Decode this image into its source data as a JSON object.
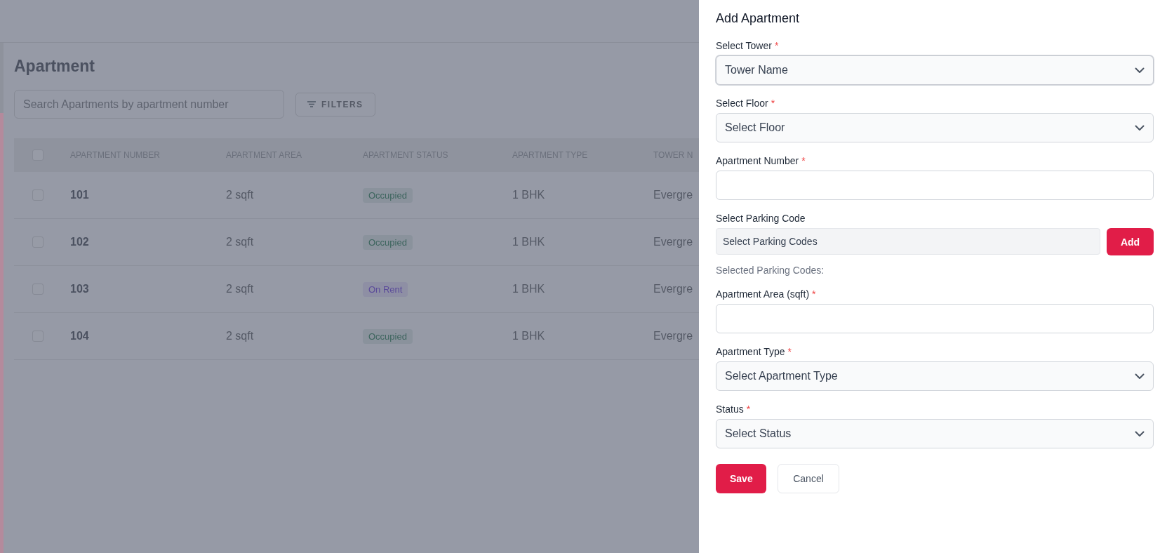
{
  "page": {
    "title": "Apartment",
    "search": {
      "placeholder": "Search Apartments by apartment number"
    },
    "filters_button": "FILTERS"
  },
  "table": {
    "header_checkbox": {
      "checked": false
    },
    "columns": [
      "APARTMENT NUMBER",
      "APARTMENT AREA",
      "APARTMENT STATUS",
      "APARTMENT TYPE",
      "TOWER N"
    ],
    "rows": [
      {
        "checked": false,
        "number": "101",
        "area": "2 sqft",
        "status": {
          "label": "Occupied",
          "color": "#3d655e"
        },
        "type": "1 BHK",
        "tower": "Evergre"
      },
      {
        "checked": false,
        "number": "102",
        "area": "2 sqft",
        "status": {
          "label": "Occupied",
          "color": "#3d655e"
        },
        "type": "1 BHK",
        "tower": "Evergre"
      },
      {
        "checked": false,
        "number": "103",
        "area": "2 sqft",
        "status": {
          "label": "On Rent",
          "color": "#5b4b9a"
        },
        "type": "1 BHK",
        "tower": "Evergre"
      },
      {
        "checked": false,
        "number": "104",
        "area": "2 sqft",
        "status": {
          "label": "Occupied",
          "color": "#3d655e"
        },
        "type": "1 BHK",
        "tower": "Evergre"
      }
    ]
  },
  "drawer": {
    "title": "Add Apartment",
    "fields": [
      {
        "kind": "select",
        "label": "Select Tower",
        "required_mark": "*",
        "value": "Tower Name",
        "focused": true
      },
      {
        "kind": "select",
        "label": "Select Floor",
        "required_mark": "*",
        "value": "Select Floor",
        "focused": false
      },
      {
        "kind": "text",
        "label": "Apartment Number",
        "required_mark": "*"
      },
      {
        "kind": "picker",
        "label": "Select Parking Code",
        "value": "Select Parking Codes",
        "button": "Add",
        "note": "Selected Parking Codes:"
      },
      {
        "kind": "text",
        "label": "Apartment Area (sqft)",
        "required_mark": "*"
      },
      {
        "kind": "select",
        "label": "Apartment Type",
        "required_mark": "*",
        "value": "Select Apartment Type",
        "focused": false
      },
      {
        "kind": "select",
        "label": "Status",
        "required_mark": "*",
        "value": "Select Status",
        "focused": false
      }
    ],
    "buttons": [
      {
        "kind": "primary",
        "label": "Save"
      },
      {
        "kind": "secondary",
        "label": "Cancel"
      }
    ]
  }
}
